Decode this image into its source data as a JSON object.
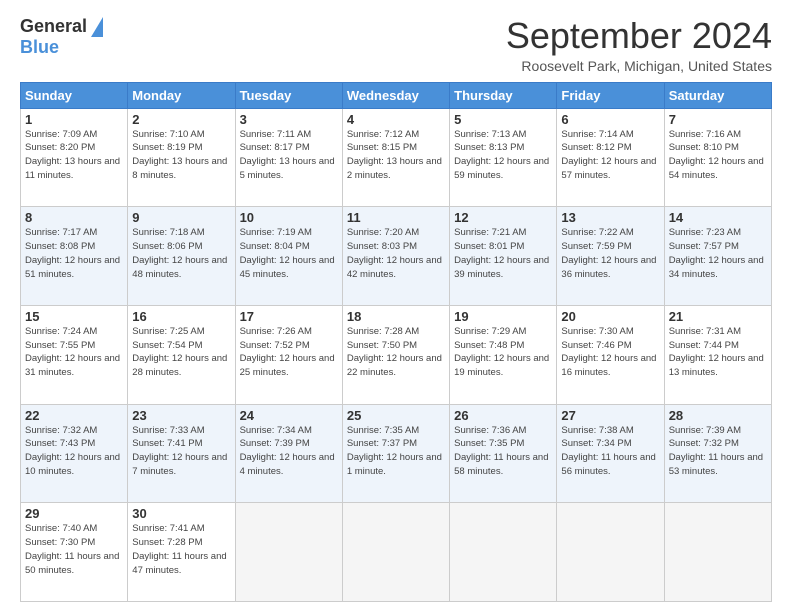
{
  "logo": {
    "general": "General",
    "blue": "Blue"
  },
  "title": "September 2024",
  "subtitle": "Roosevelt Park, Michigan, United States",
  "days_header": [
    "Sunday",
    "Monday",
    "Tuesday",
    "Wednesday",
    "Thursday",
    "Friday",
    "Saturday"
  ],
  "weeks": [
    [
      {
        "num": "1",
        "sunrise": "7:09 AM",
        "sunset": "8:20 PM",
        "daylight": "13 hours and 11 minutes."
      },
      {
        "num": "2",
        "sunrise": "7:10 AM",
        "sunset": "8:19 PM",
        "daylight": "13 hours and 8 minutes."
      },
      {
        "num": "3",
        "sunrise": "7:11 AM",
        "sunset": "8:17 PM",
        "daylight": "13 hours and 5 minutes."
      },
      {
        "num": "4",
        "sunrise": "7:12 AM",
        "sunset": "8:15 PM",
        "daylight": "13 hours and 2 minutes."
      },
      {
        "num": "5",
        "sunrise": "7:13 AM",
        "sunset": "8:13 PM",
        "daylight": "12 hours and 59 minutes."
      },
      {
        "num": "6",
        "sunrise": "7:14 AM",
        "sunset": "8:12 PM",
        "daylight": "12 hours and 57 minutes."
      },
      {
        "num": "7",
        "sunrise": "7:16 AM",
        "sunset": "8:10 PM",
        "daylight": "12 hours and 54 minutes."
      }
    ],
    [
      {
        "num": "8",
        "sunrise": "7:17 AM",
        "sunset": "8:08 PM",
        "daylight": "12 hours and 51 minutes."
      },
      {
        "num": "9",
        "sunrise": "7:18 AM",
        "sunset": "8:06 PM",
        "daylight": "12 hours and 48 minutes."
      },
      {
        "num": "10",
        "sunrise": "7:19 AM",
        "sunset": "8:04 PM",
        "daylight": "12 hours and 45 minutes."
      },
      {
        "num": "11",
        "sunrise": "7:20 AM",
        "sunset": "8:03 PM",
        "daylight": "12 hours and 42 minutes."
      },
      {
        "num": "12",
        "sunrise": "7:21 AM",
        "sunset": "8:01 PM",
        "daylight": "12 hours and 39 minutes."
      },
      {
        "num": "13",
        "sunrise": "7:22 AM",
        "sunset": "7:59 PM",
        "daylight": "12 hours and 36 minutes."
      },
      {
        "num": "14",
        "sunrise": "7:23 AM",
        "sunset": "7:57 PM",
        "daylight": "12 hours and 34 minutes."
      }
    ],
    [
      {
        "num": "15",
        "sunrise": "7:24 AM",
        "sunset": "7:55 PM",
        "daylight": "12 hours and 31 minutes."
      },
      {
        "num": "16",
        "sunrise": "7:25 AM",
        "sunset": "7:54 PM",
        "daylight": "12 hours and 28 minutes."
      },
      {
        "num": "17",
        "sunrise": "7:26 AM",
        "sunset": "7:52 PM",
        "daylight": "12 hours and 25 minutes."
      },
      {
        "num": "18",
        "sunrise": "7:28 AM",
        "sunset": "7:50 PM",
        "daylight": "12 hours and 22 minutes."
      },
      {
        "num": "19",
        "sunrise": "7:29 AM",
        "sunset": "7:48 PM",
        "daylight": "12 hours and 19 minutes."
      },
      {
        "num": "20",
        "sunrise": "7:30 AM",
        "sunset": "7:46 PM",
        "daylight": "12 hours and 16 minutes."
      },
      {
        "num": "21",
        "sunrise": "7:31 AM",
        "sunset": "7:44 PM",
        "daylight": "12 hours and 13 minutes."
      }
    ],
    [
      {
        "num": "22",
        "sunrise": "7:32 AM",
        "sunset": "7:43 PM",
        "daylight": "12 hours and 10 minutes."
      },
      {
        "num": "23",
        "sunrise": "7:33 AM",
        "sunset": "7:41 PM",
        "daylight": "12 hours and 7 minutes."
      },
      {
        "num": "24",
        "sunrise": "7:34 AM",
        "sunset": "7:39 PM",
        "daylight": "12 hours and 4 minutes."
      },
      {
        "num": "25",
        "sunrise": "7:35 AM",
        "sunset": "7:37 PM",
        "daylight": "12 hours and 1 minute."
      },
      {
        "num": "26",
        "sunrise": "7:36 AM",
        "sunset": "7:35 PM",
        "daylight": "11 hours and 58 minutes."
      },
      {
        "num": "27",
        "sunrise": "7:38 AM",
        "sunset": "7:34 PM",
        "daylight": "11 hours and 56 minutes."
      },
      {
        "num": "28",
        "sunrise": "7:39 AM",
        "sunset": "7:32 PM",
        "daylight": "11 hours and 53 minutes."
      }
    ],
    [
      {
        "num": "29",
        "sunrise": "7:40 AM",
        "sunset": "7:30 PM",
        "daylight": "11 hours and 50 minutes."
      },
      {
        "num": "30",
        "sunrise": "7:41 AM",
        "sunset": "7:28 PM",
        "daylight": "11 hours and 47 minutes."
      },
      null,
      null,
      null,
      null,
      null
    ]
  ]
}
